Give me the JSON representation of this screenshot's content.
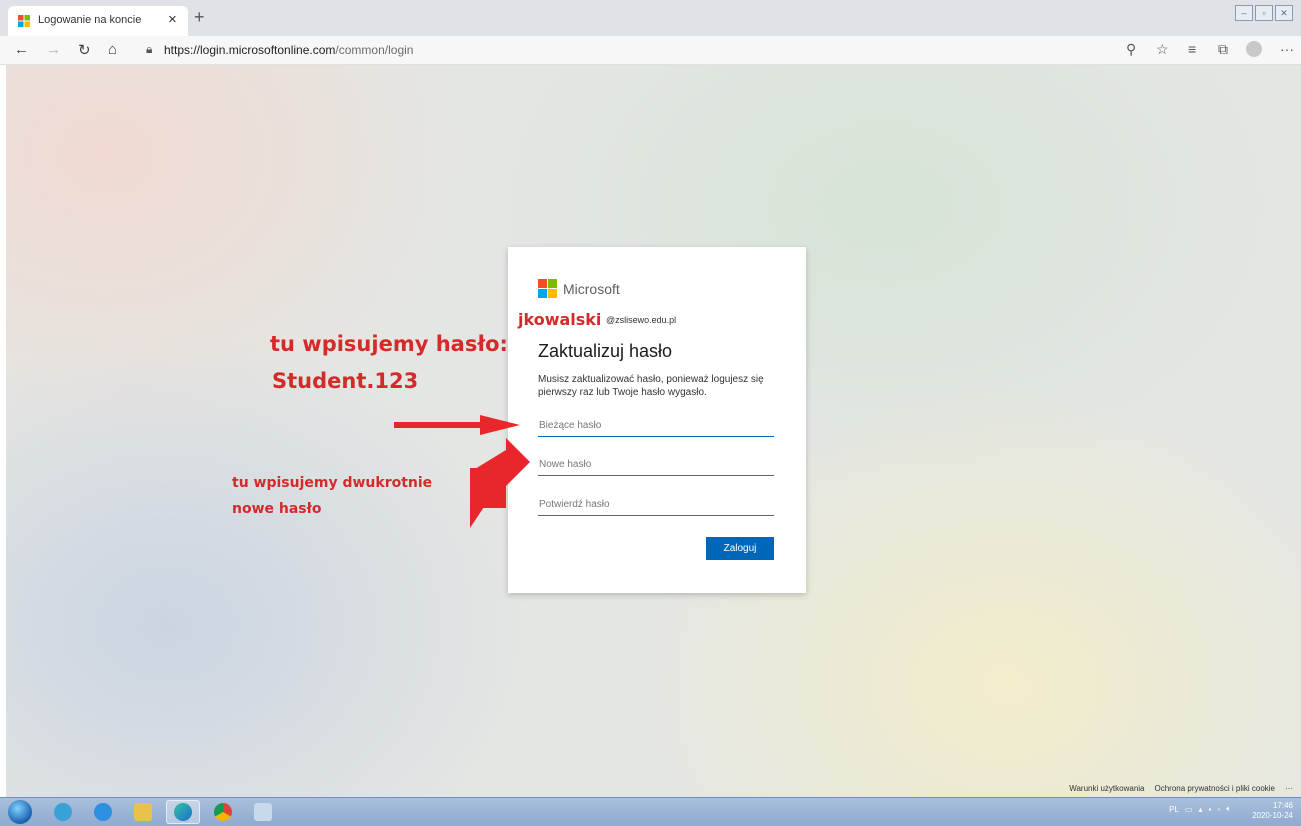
{
  "browser": {
    "tab_title": "Logowanie na koncie",
    "tab_close": "×",
    "new_tab": "+",
    "url_host": "https://login.microsoftonline.com",
    "url_path": "/common/login"
  },
  "login": {
    "brand": "Microsoft",
    "username_annotation": "jkowalski",
    "username_domain": "@zslisewo.edu.pl",
    "title": "Zaktualizuj hasło",
    "description": "Musisz zaktualizować hasło, ponieważ logujesz się pierwszy raz lub Twoje hasło wygasło.",
    "current_password_placeholder": "Bieżące hasło",
    "new_password_placeholder": "Nowe hasło",
    "confirm_password_placeholder": "Potwierdź hasło",
    "submit_label": "Zaloguj"
  },
  "annotations": {
    "line1": "tu wpisujemy hasło:",
    "line2": "Student.123",
    "line3": "tu wpisujemy dwukrotnie",
    "line4": "nowe hasło"
  },
  "footer": {
    "terms": "Warunki użytkowania",
    "privacy": "Ochrona prywatności i pliki cookie",
    "more": "···"
  },
  "taskbar": {
    "lang": "PL",
    "time": "17:46",
    "date": "2020-10-24"
  },
  "colors": {
    "annotation_red": "#d42a2a",
    "ms_blue": "#0067b8",
    "logo_red": "#f25022",
    "logo_green": "#7fba00",
    "logo_blue": "#00a4ef",
    "logo_yellow": "#ffb900"
  }
}
